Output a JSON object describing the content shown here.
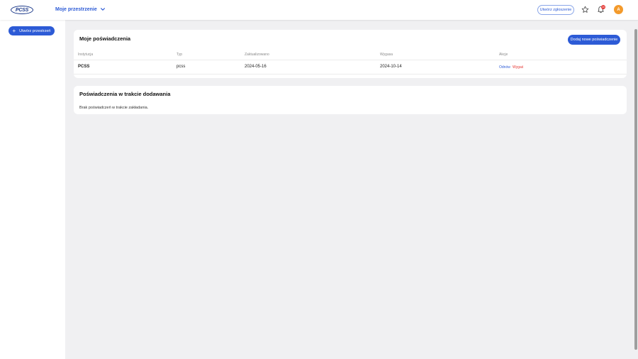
{
  "header": {
    "logo_text": "PCSS",
    "space_selector": "Moje przestrzenie",
    "report_button": "Utwórz zgłoszenie",
    "notification_count": "10",
    "avatar_initial": "A"
  },
  "sidebar": {
    "create_space_button": "Utwórz przestrzeń"
  },
  "credentials": {
    "title": "Moje poświadczenia",
    "add_button": "Dodaj nowe poświadczenie",
    "columns": [
      "Instytucja",
      "Typ",
      "Zaktualizowano",
      "Wygasa",
      "Akcje"
    ],
    "rows": [
      {
        "institution": "PCSS",
        "type": "pcss",
        "updated": "2024-05-16",
        "expires": "2024-10-14",
        "action_renew": "Odnów",
        "action_expire": "Wygaś"
      }
    ]
  },
  "pending": {
    "title": "Poświadczenia w trakcie dodawania",
    "empty_message": "Brak poświadczeń w trakcie zakładania."
  },
  "colors": {
    "accent": "#2d5bd6",
    "danger": "#e53935",
    "avatar": "#f39a2b",
    "background": "#f0f0f2"
  }
}
